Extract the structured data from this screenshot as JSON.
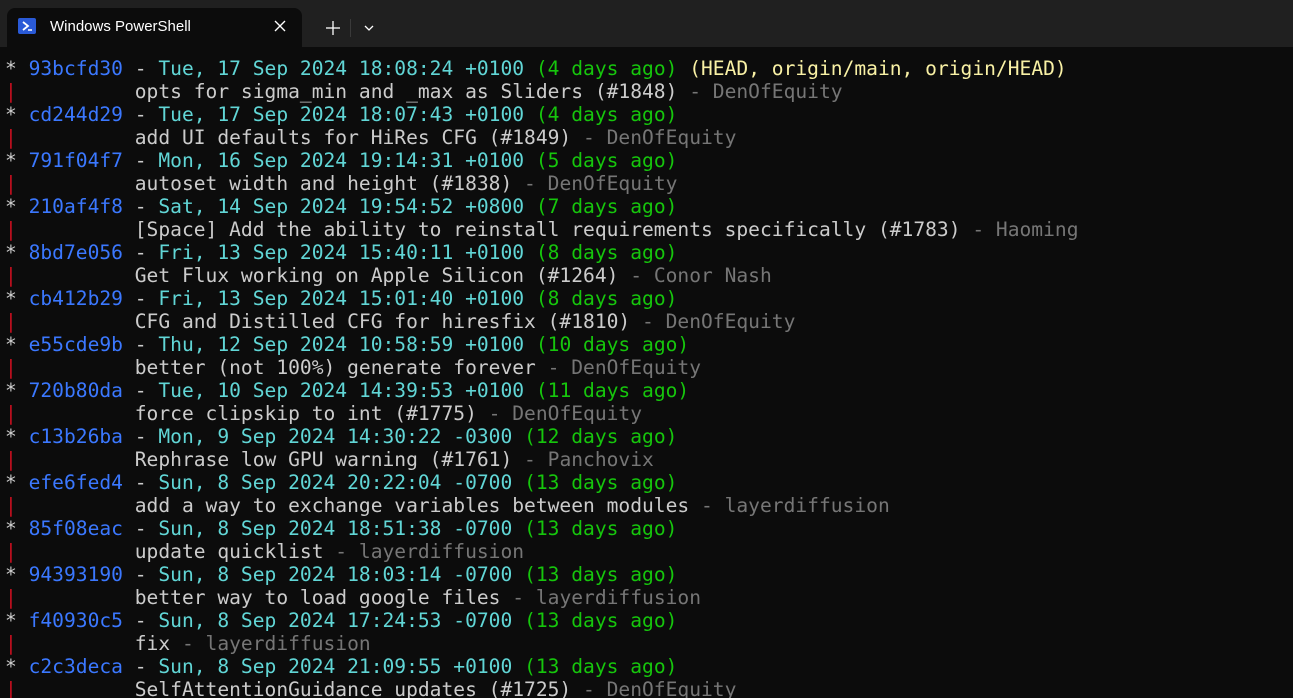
{
  "window": {
    "tab_title": "Windows PowerShell",
    "icons": {
      "tab_icon": "powershell-icon",
      "close": "close-icon",
      "new_tab": "plus-icon",
      "dropdown": "chevron-down-icon"
    }
  },
  "colors": {
    "background": "#0c0c0c",
    "titlebar": "#202020",
    "hash": "#3b78ff",
    "date": "#61d6d6",
    "relative": "#16c60c",
    "refs": "#f9f1a5",
    "message": "#cccccc",
    "author": "#767676",
    "graph_bar": "#c50f1f"
  },
  "terminal": {
    "graph_star": "*",
    "graph_bar": "|",
    "separator": " - ",
    "commits": [
      {
        "hash": "93bcfd30",
        "date": "Tue, 17 Sep 2024 18:08:24 +0100",
        "relative": "(4 days ago)",
        "refs": "(HEAD, origin/main, origin/HEAD)",
        "message": "opts for sigma_min and _max as Sliders (#1848)",
        "author": "DenOfEquity"
      },
      {
        "hash": "cd244d29",
        "date": "Tue, 17 Sep 2024 18:07:43 +0100",
        "relative": "(4 days ago)",
        "refs": "",
        "message": "add UI defaults for HiRes CFG (#1849)",
        "author": "DenOfEquity"
      },
      {
        "hash": "791f04f7",
        "date": "Mon, 16 Sep 2024 19:14:31 +0100",
        "relative": "(5 days ago)",
        "refs": "",
        "message": "autoset width and height (#1838)",
        "author": "DenOfEquity"
      },
      {
        "hash": "210af4f8",
        "date": "Sat, 14 Sep 2024 19:54:52 +0800",
        "relative": "(7 days ago)",
        "refs": "",
        "message": "[Space] Add the ability to reinstall requirements specifically (#1783)",
        "author": "Haoming"
      },
      {
        "hash": "8bd7e056",
        "date": "Fri, 13 Sep 2024 15:40:11 +0100",
        "relative": "(8 days ago)",
        "refs": "",
        "message": "Get Flux working on Apple Silicon (#1264)",
        "author": "Conor Nash"
      },
      {
        "hash": "cb412b29",
        "date": "Fri, 13 Sep 2024 15:01:40 +0100",
        "relative": "(8 days ago)",
        "refs": "",
        "message": "CFG and Distilled CFG for hiresfix (#1810)",
        "author": "DenOfEquity"
      },
      {
        "hash": "e55cde9b",
        "date": "Thu, 12 Sep 2024 10:58:59 +0100",
        "relative": "(10 days ago)",
        "refs": "",
        "message": "better (not 100%) generate forever",
        "author": "DenOfEquity"
      },
      {
        "hash": "720b80da",
        "date": "Tue, 10 Sep 2024 14:39:53 +0100",
        "relative": "(11 days ago)",
        "refs": "",
        "message": "force clipskip to int (#1775)",
        "author": "DenOfEquity"
      },
      {
        "hash": "c13b26ba",
        "date": "Mon, 9 Sep 2024 14:30:22 -0300",
        "relative": "(12 days ago)",
        "refs": "",
        "message": "Rephrase low GPU warning (#1761)",
        "author": "Panchovix"
      },
      {
        "hash": "efe6fed4",
        "date": "Sun, 8 Sep 2024 20:22:04 -0700",
        "relative": "(13 days ago)",
        "refs": "",
        "message": "add a way to exchange variables between modules",
        "author": "layerdiffusion"
      },
      {
        "hash": "85f08eac",
        "date": "Sun, 8 Sep 2024 18:51:38 -0700",
        "relative": "(13 days ago)",
        "refs": "",
        "message": "update quicklist",
        "author": "layerdiffusion"
      },
      {
        "hash": "94393190",
        "date": "Sun, 8 Sep 2024 18:03:14 -0700",
        "relative": "(13 days ago)",
        "refs": "",
        "message": "better way to load google files",
        "author": "layerdiffusion"
      },
      {
        "hash": "f40930c5",
        "date": "Sun, 8 Sep 2024 17:24:53 -0700",
        "relative": "(13 days ago)",
        "refs": "",
        "message": "fix",
        "author": "layerdiffusion"
      },
      {
        "hash": "c2c3deca",
        "date": "Sun, 8 Sep 2024 21:09:55 +0100",
        "relative": "(13 days ago)",
        "refs": "",
        "message": "SelfAttentionGuidance updates (#1725)",
        "author": "DenOfEquity"
      }
    ]
  }
}
